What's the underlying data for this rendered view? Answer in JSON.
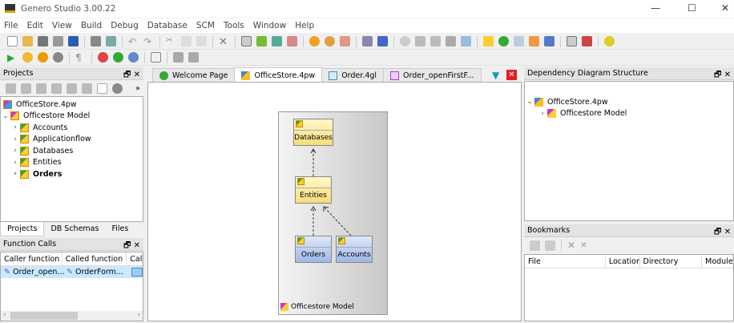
{
  "window": {
    "title": "Genero Studio 3.00.22",
    "min": "—",
    "max": "☐",
    "close": "✕"
  },
  "menu": [
    "File",
    "Edit",
    "View",
    "Build",
    "Debug",
    "Database",
    "SCM",
    "Tools",
    "Window",
    "Help"
  ],
  "projects_panel": {
    "title": "Projects",
    "tree": [
      {
        "label": "OfficeStore.4pw",
        "level": 0,
        "bold": false
      },
      {
        "label": "Officestore Model",
        "level": 1,
        "expanded": true
      },
      {
        "label": "Accounts",
        "level": 2
      },
      {
        "label": "Applicationflow",
        "level": 2
      },
      {
        "label": "Databases",
        "level": 2
      },
      {
        "label": "Entities",
        "level": 2
      },
      {
        "label": "Orders",
        "level": 2,
        "bold": true
      }
    ],
    "tabs": [
      "Projects",
      "DB Schemas",
      "Files"
    ],
    "active_tab": "Projects"
  },
  "function_calls": {
    "title": "Function Calls",
    "columns": [
      "Caller function",
      "Called function",
      "Cal"
    ],
    "rows": [
      [
        "Order_open...",
        "OrderForm...",
        ""
      ]
    ]
  },
  "editor": {
    "tabs": [
      "Welcome Page",
      "OfficeStore.4pw",
      "Order.4gl",
      "Order_openFirstF..."
    ],
    "active_tab": "OfficeStore.4pw",
    "diagram": {
      "group": "Officestore Model",
      "nodes": [
        "Databases",
        "Entities",
        "Orders",
        "Accounts"
      ]
    }
  },
  "dependency": {
    "title": "Dependency Diagram Structure",
    "tree": [
      "OfficeStore.4pw",
      "Officestore Model"
    ]
  },
  "bookmarks": {
    "title": "Bookmarks",
    "columns": [
      "File",
      "Location",
      "Directory",
      "Module"
    ]
  },
  "colors": {
    "selection": "#cce8ff",
    "yellow_node": "#f6dd7a",
    "blue_node": "#9fb6e6",
    "close_red": "#e02020"
  }
}
